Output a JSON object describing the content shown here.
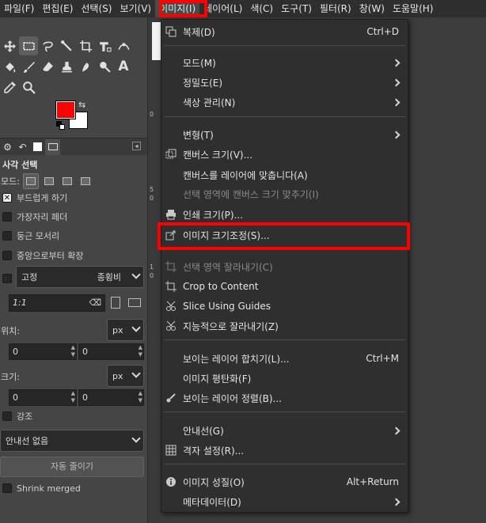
{
  "menubar": {
    "items": [
      {
        "label": "파일(F)"
      },
      {
        "label": "편집(E)"
      },
      {
        "label": "선택(S)"
      },
      {
        "label": "보기(V)"
      },
      {
        "label": "이미지(I)"
      },
      {
        "label": "레이어(L)"
      },
      {
        "label": "색(C)"
      },
      {
        "label": "도구(T)"
      },
      {
        "label": "필터(R)"
      },
      {
        "label": "창(W)"
      },
      {
        "label": "도움말(H)"
      }
    ],
    "active_index": 4
  },
  "toolbox": {
    "tools_row1": [
      "move-tool-icon",
      "rect-select-tool-icon",
      "free-select-tool-icon",
      "fuzzy-select-tool-icon",
      "crop-tool-icon",
      "unified-transform-tool-icon",
      "warp-transform-tool-icon"
    ],
    "tools_row2": [
      "bucket-fill-tool-icon",
      "paintbrush-tool-icon",
      "eraser-tool-icon",
      "clone-tool-icon",
      "smudge-tool-icon",
      "dodge-burn-tool-icon",
      "text-tool-icon"
    ],
    "tools_row3": [
      "color-picker-tool-icon",
      "zoom-tool-icon"
    ],
    "text_tool_glyph": "A",
    "fg_color": "#ff0000",
    "bg_color": "#ffffff"
  },
  "tool_options": {
    "title": "사각 선택",
    "mode_label": "모드:",
    "antialias_label": "부드럽게 하기",
    "feather_label": "가장자리 페더",
    "rounded_label": "둥근 모서리",
    "expand_center_label": "중앙으로부터 확장",
    "fixed_label": "고정",
    "fixed_value": "종횡비",
    "ratio_value": "1:1",
    "position_label": "위치:",
    "position_unit": "px",
    "pos_x": "0",
    "pos_y": "0",
    "size_label": "크기:",
    "size_unit": "px",
    "size_w": "0",
    "size_h": "0",
    "highlight_label": "강조",
    "guides_value": "안내선 없음",
    "autoshrink_label": "자동 줄이기",
    "shrink_merged_label": "Shrink merged"
  },
  "canvas": {
    "ruler_labels": [
      "0",
      "5",
      "0",
      "1",
      "0"
    ]
  },
  "image_menu": {
    "items": [
      {
        "label": "복제(D)",
        "shortcut": "Ctrl+D",
        "icon": "duplicate-icon"
      },
      {
        "label": "모드(M)",
        "submenu": true
      },
      {
        "label": "정밀도(E)",
        "submenu": true
      },
      {
        "label": "색상 관리(N)",
        "submenu": true
      },
      {
        "label": "변형(T)",
        "submenu": true
      },
      {
        "label": "캔버스 크기(V)...",
        "icon": "canvas-size-icon"
      },
      {
        "label": "캔버스를 레이어에 맞춥니다(A)"
      },
      {
        "label": "선택 영역에 캔버스 크기 맞추기(I)",
        "disabled": true
      },
      {
        "label": "인쇄 크기(P)...",
        "icon": "print-icon"
      },
      {
        "label": "이미지 크기조정(S)...",
        "icon": "scale-image-icon",
        "highlighted": true
      },
      {
        "label": "선택 영역 잘라내기(C)",
        "disabled": true,
        "icon": "crop-to-selection-icon"
      },
      {
        "label": "Crop to Content",
        "icon": "crop-to-content-icon"
      },
      {
        "label": "Slice Using Guides",
        "icon": "slice-icon"
      },
      {
        "label": "지능적으로 잘라내기(Z)",
        "icon": "zealous-crop-icon"
      },
      {
        "label": "보이는 레이어 합치기(L)...",
        "shortcut": "Ctrl+M"
      },
      {
        "label": "이미지 평탄화(F)"
      },
      {
        "label": "보이는 레이어 정렬(B)...",
        "icon": "align-layers-icon"
      },
      {
        "label": "안내선(G)",
        "submenu": true
      },
      {
        "label": "격자 설정(R)...",
        "icon": "grid-icon"
      },
      {
        "label": "이미지 성질(O)",
        "shortcut": "Alt+Return",
        "icon": "info-icon"
      },
      {
        "label": "메타데이터(D)",
        "submenu": true
      }
    ]
  },
  "highlight_color": "#ff0000"
}
